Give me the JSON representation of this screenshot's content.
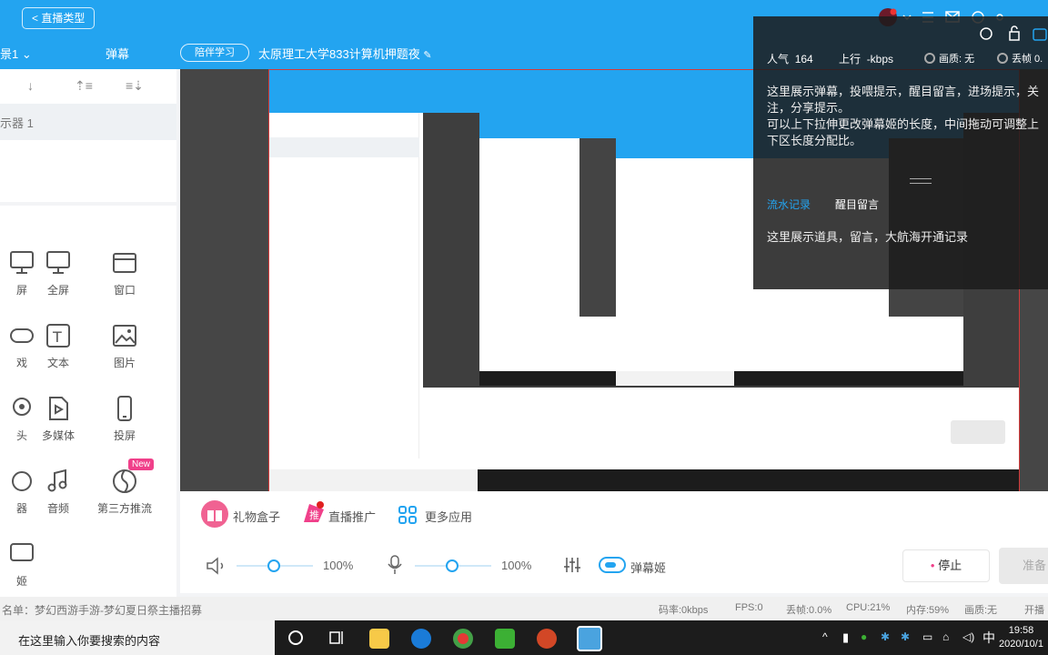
{
  "topbar": {
    "back_label": "< 直播类型"
  },
  "subbar": {
    "scene_label": "景1",
    "danmaku_tab": "弹幕",
    "tag": "陪伴学习",
    "room_title": "太原理工大学833计算机押题夜"
  },
  "left_panel": {
    "display_item": "示器 1",
    "sources": [
      {
        "label": "屏",
        "icon": "monitor-icon"
      },
      {
        "label": "全屏",
        "icon": "monitor-icon"
      },
      {
        "label": "窗口",
        "icon": "window-icon"
      },
      {
        "label": "戏",
        "icon": "game-icon"
      },
      {
        "label": "文本",
        "icon": "text-icon"
      },
      {
        "label": "图片",
        "icon": "image-icon"
      },
      {
        "label": "头",
        "icon": "camera-icon"
      },
      {
        "label": "多媒体",
        "icon": "media-icon"
      },
      {
        "label": "投屏",
        "icon": "phone-icon"
      },
      {
        "label": "器",
        "icon": "browser-icon"
      },
      {
        "label": "音频",
        "icon": "music-icon"
      },
      {
        "label": "第三方推流",
        "icon": "stream-icon",
        "badge": "New"
      },
      {
        "label": "姬",
        "icon": "danmaku-icon"
      }
    ]
  },
  "controls": {
    "gift_box": "礼物盒子",
    "promo": "直播推广",
    "more_apps": "更多应用",
    "speaker_pct": "100%",
    "mic_pct": "100%",
    "danmaku_toggle": "弹幕姬",
    "stop": "停止",
    "ready": "准备"
  },
  "status": {
    "ad_list": "名单：梦幻西游手游-梦幻夏日祭主播招募",
    "bitrate": "码率:0kbps",
    "fps": "FPS:0",
    "dropped": "丢帧:0.0%",
    "cpu": "CPU:21%",
    "mem": "内存:59%",
    "quality": "画质:无",
    "broadcast": "开播"
  },
  "taskbar": {
    "search": "在这里输入你要搜索的内容",
    "ime": "中",
    "time": "19:58",
    "date": "2020/10/1"
  },
  "overlay": {
    "popularity_label": "人气",
    "popularity_value": "164",
    "upload_label": "上行",
    "upload_value": "-kbps",
    "quality_label": "画质: 无",
    "drop_label": "丢帧 0.",
    "hint_text": "这里展示弹幕，投喂提示，醒目留言，进场提示，关注，分享提示。",
    "hint_text2": "可以上下拉伸更改弹幕姬的长度，中间拖动可调整上下区长度分配比。",
    "tab_flow": "流水记录",
    "tab_superchat": "醒目留言",
    "flow_text": "这里展示道具，留言，大航海开通记录"
  },
  "colors": {
    "brand_blue": "#23a4f0",
    "pink": "#f0408a",
    "dark": "#1c1c1c"
  }
}
